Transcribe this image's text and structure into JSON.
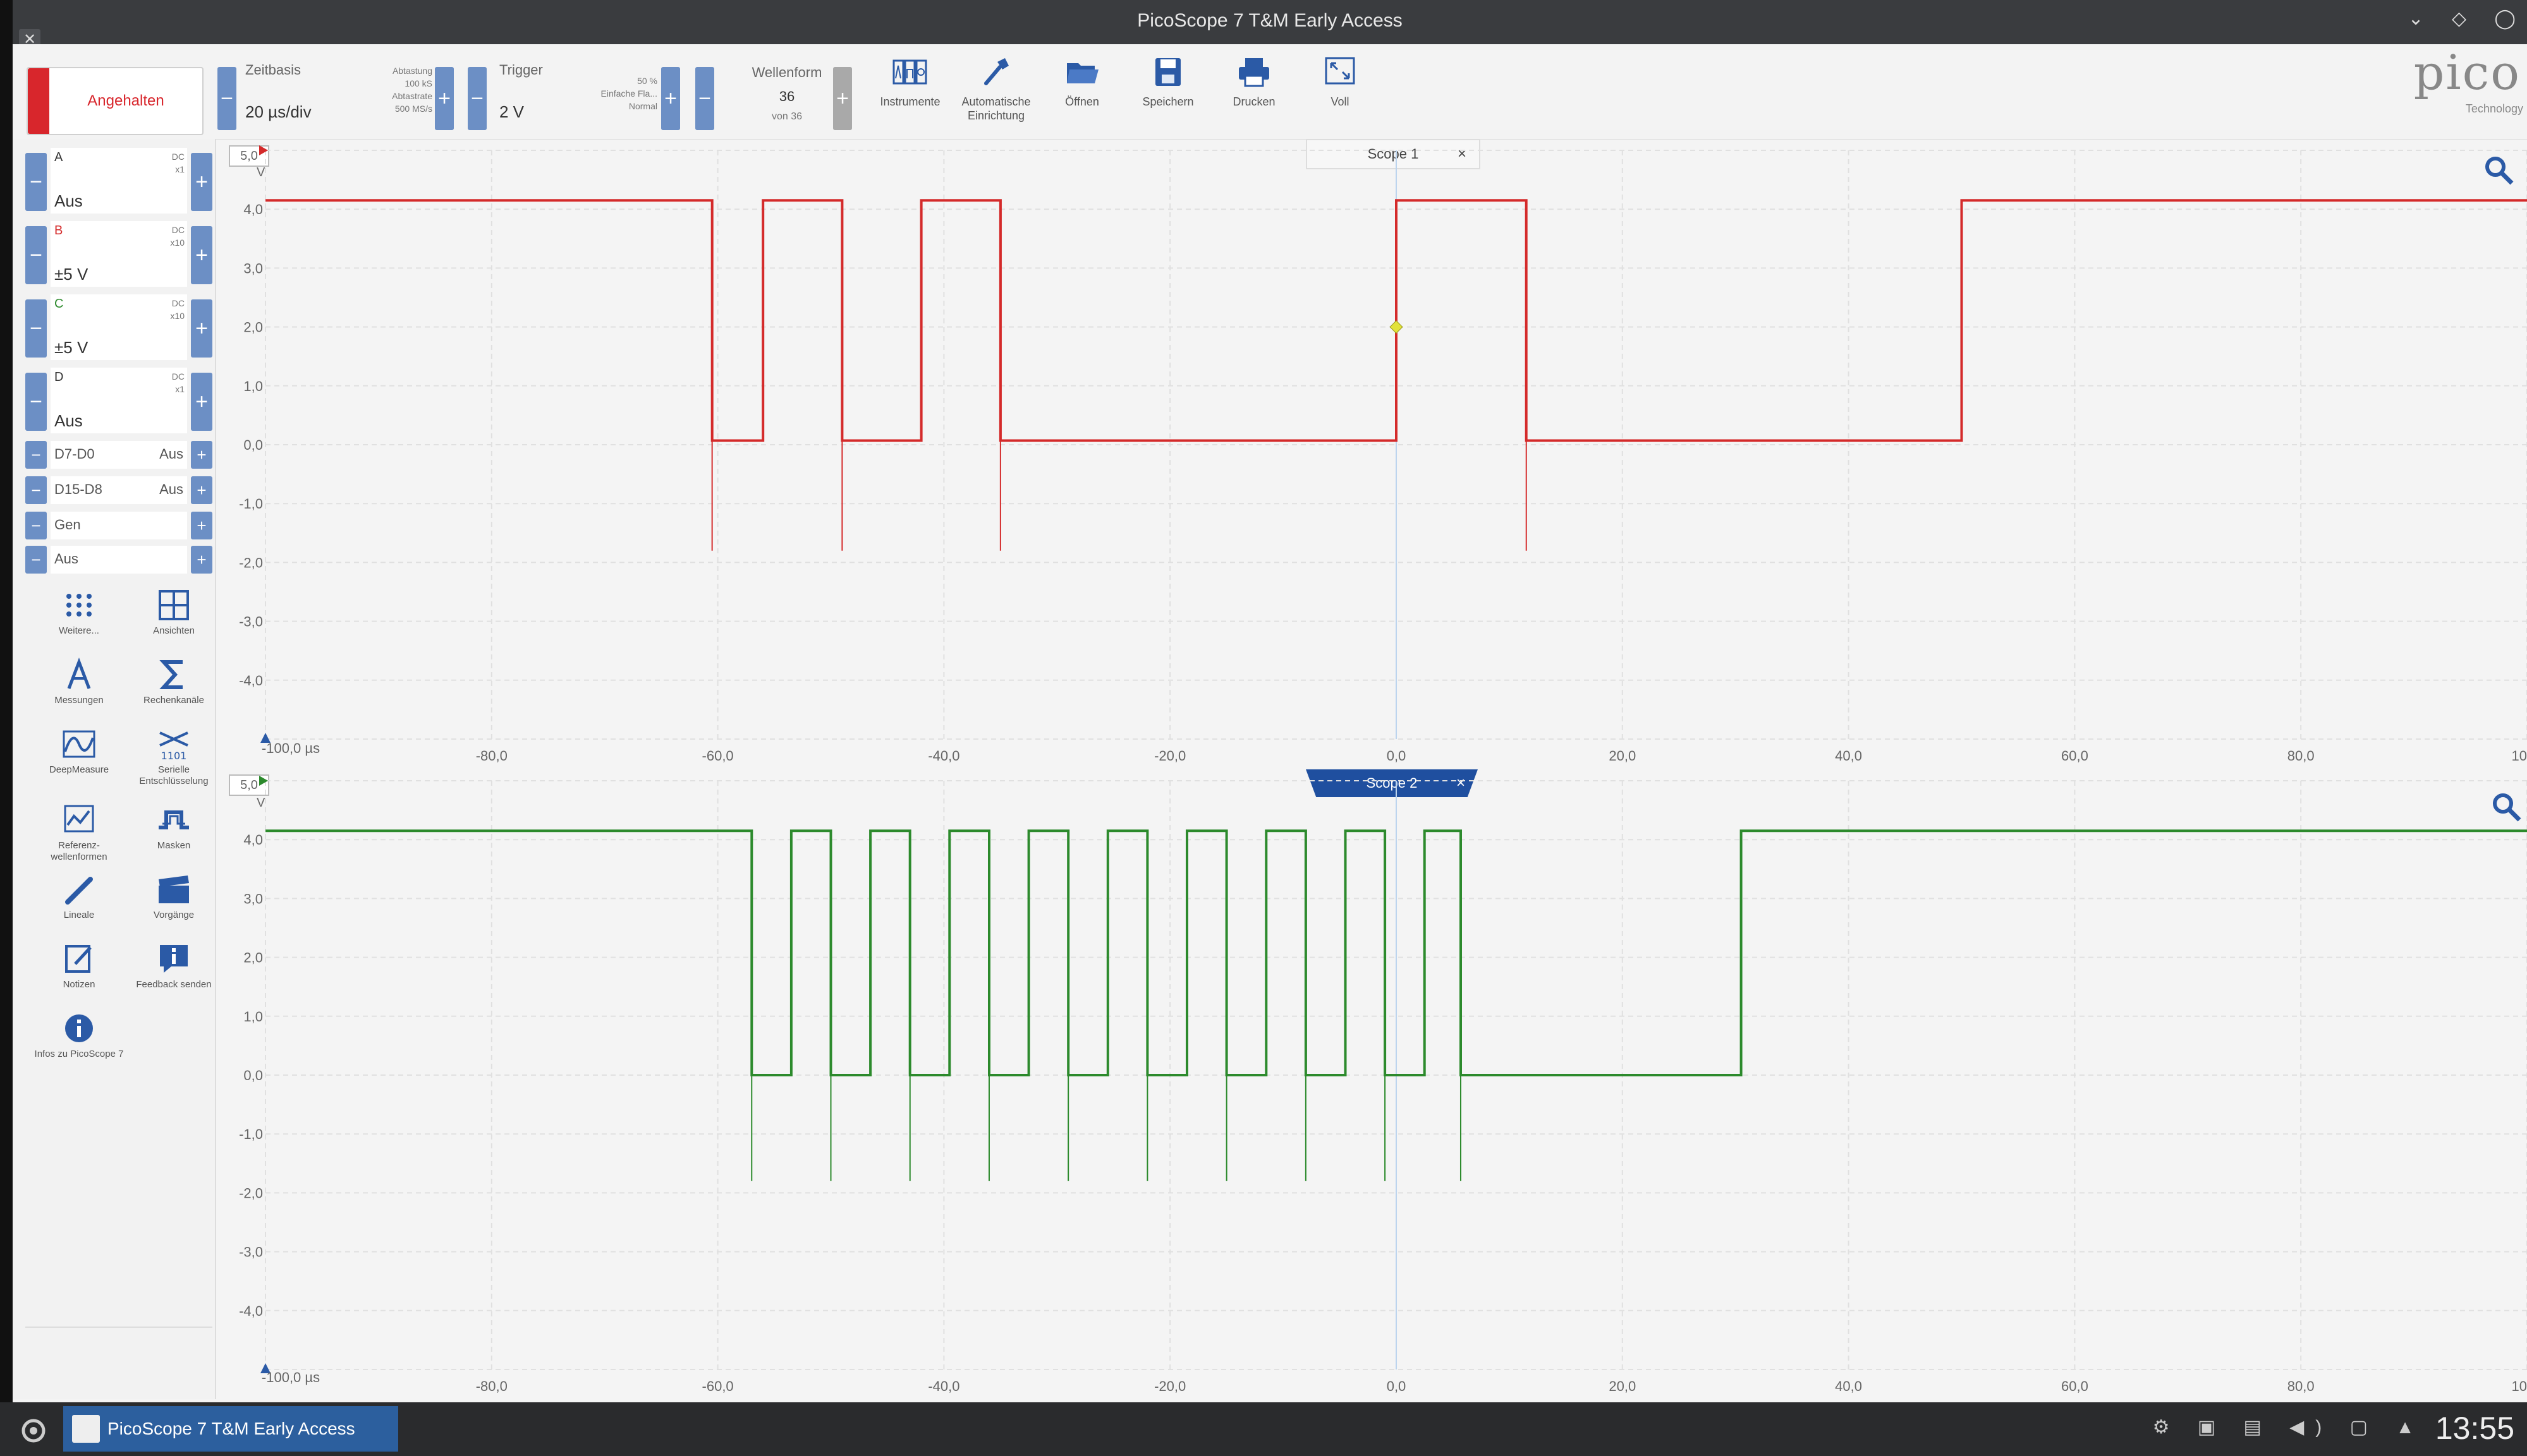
{
  "window": {
    "title": "PicoScope 7 T&M Early Access"
  },
  "toolbar": {
    "run_label": "Angehalten",
    "timebase": {
      "caption": "Zeitbasis",
      "value": "20 µs/div",
      "sub1": "Abtastung",
      "sub2": "100 kS",
      "sub3": "Abtastrate",
      "sub4": "500 MS/s"
    },
    "trigger": {
      "caption": "Trigger",
      "value": "2 V",
      "sub1": "50 %",
      "sub2": "Einfache Fla...",
      "sub3": "Normal"
    },
    "waveform": {
      "caption": "Wellenform",
      "value": "36",
      "sub": "von 36"
    },
    "buttons": [
      {
        "id": "instrumente",
        "label": "Instrumente",
        "icon": "instruments-icon"
      },
      {
        "id": "auto",
        "label": "Automatische Einrichtung",
        "icon": "auto-setup-icon"
      },
      {
        "id": "open",
        "label": "Öffnen",
        "icon": "folder-open-icon"
      },
      {
        "id": "save",
        "label": "Speichern",
        "icon": "save-icon"
      },
      {
        "id": "print",
        "label": "Drucken",
        "icon": "print-icon"
      },
      {
        "id": "full",
        "label": "Voll",
        "icon": "fullscreen-icon"
      }
    ],
    "brand": "pico",
    "brand_sub": "Technology"
  },
  "channels": [
    {
      "name": "A",
      "coupling": "DC",
      "probe": "x1",
      "value": "Aus"
    },
    {
      "name": "B",
      "coupling": "DC",
      "probe": "x10",
      "value": "±5 V"
    },
    {
      "name": "C",
      "coupling": "DC",
      "probe": "x10",
      "value": "±5 V"
    },
    {
      "name": "D",
      "coupling": "DC",
      "probe": "x1",
      "value": "Aus"
    }
  ],
  "digital": [
    {
      "name": "D7-D0",
      "value": "Aus"
    },
    {
      "name": "D15-D8",
      "value": "Aus"
    },
    {
      "name": "Gen",
      "value": ""
    },
    {
      "name": "Aus",
      "value": ""
    }
  ],
  "tools": [
    {
      "label": "Weitere...",
      "icon": "more-dots-icon"
    },
    {
      "label": "Ansichten",
      "icon": "views-grid-icon"
    },
    {
      "label": "Messungen",
      "icon": "measurements-icon"
    },
    {
      "label": "Rechenkanäle",
      "icon": "sigma-icon"
    },
    {
      "label": "DeepMeasure",
      "icon": "deepmeasure-icon"
    },
    {
      "label": "Serielle Entschlüsselung",
      "icon": "serial-decode-icon"
    },
    {
      "label": "Referenz-wellenformen",
      "icon": "reference-waveform-icon"
    },
    {
      "label": "Masken",
      "icon": "masks-icon"
    },
    {
      "label": "Lineale",
      "icon": "ruler-icon"
    },
    {
      "label": "Vorgänge",
      "icon": "actions-clapper-icon"
    },
    {
      "label": "Notizen",
      "icon": "notes-icon"
    },
    {
      "label": "Feedback senden",
      "icon": "feedback-icon"
    },
    {
      "label": "Infos zu PicoScope 7",
      "icon": "info-icon"
    }
  ],
  "scopes": [
    {
      "tab": "Scope 1",
      "color": "#d42a2a",
      "y_top_label": "5,0",
      "y_unit": "V",
      "x_unit_label": "-100,0 µs",
      "edges_us": [
        -60.5,
        -56,
        -49,
        -42,
        -35,
        0,
        11.5,
        50
      ],
      "high_v": 4.15,
      "low_v": 0.07,
      "start_high": true
    },
    {
      "tab": "Scope 2",
      "color": "#2c8a2c",
      "y_top_label": "5,0",
      "y_unit": "V",
      "x_unit_label": "-100,0 µs",
      "edges_us": [
        -57,
        -53.5,
        -50,
        -46.5,
        -43,
        -39.5,
        -36,
        -32.5,
        -29,
        -25.5,
        -22,
        -18.5,
        -15,
        -11.5,
        -8,
        -4.5,
        -1,
        2.5,
        5.7,
        30.5
      ],
      "high_v": 4.15,
      "low_v": 0.0,
      "start_high": true
    }
  ],
  "axis": {
    "y_ticks": [
      "4,0",
      "3,0",
      "2,0",
      "1,0",
      "0,0",
      "-1,0",
      "-2,0",
      "-3,0",
      "-4,0"
    ],
    "x_ticks": [
      "-80,0",
      "-60,0",
      "-40,0",
      "-20,0",
      "0,0",
      "20,0",
      "40,0",
      "60,0",
      "80,0",
      "10"
    ]
  },
  "taskbar": {
    "task_label": "PicoScope 7 T&M Early Access",
    "clock": "13:55"
  },
  "colors": {
    "accent": "#6c8fc5",
    "tab_active": "#1f4f9f",
    "run_red": "#d8262c"
  }
}
